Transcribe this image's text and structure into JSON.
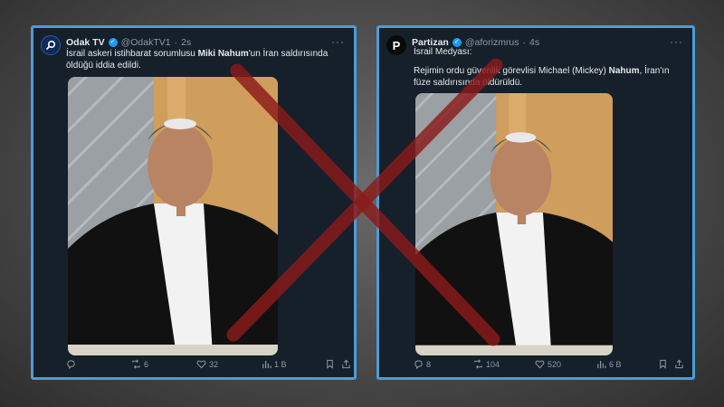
{
  "left_post": {
    "name": "Odak TV",
    "handle": "@OdakTV1",
    "time": "2s",
    "text_pre": "İsrail askeri istihbarat sorumlusu ",
    "text_bold": "Miki Nahum",
    "text_post": "'un İran saldırısında öldüğü iddia edildi.",
    "replies": "",
    "retweets": "6",
    "likes": "32",
    "views": "1 B"
  },
  "right_post": {
    "name": "Partizan",
    "handle": "@aforizmrus",
    "time": "4s",
    "line1": "İsrail Medyası:",
    "text_pre": "Rejimin ordu güvenlik görevlisi Michael (Mickey) ",
    "text_bold": "Nahum",
    "text_post": ", İran'ın füze saldırısında öldürüldü.",
    "replies": "8",
    "retweets": "104",
    "likes": "520",
    "views": "6 B"
  },
  "colors": {
    "card_bg": "#15202b",
    "card_border": "#4c9cd6",
    "cross": "#8b1a1a",
    "verified": "#1d9bf0"
  },
  "icons": [
    "search-icon",
    "verified-icon",
    "more-icon",
    "reply-icon",
    "retweet-icon",
    "like-icon",
    "views-icon",
    "bookmark-icon",
    "share-icon"
  ]
}
